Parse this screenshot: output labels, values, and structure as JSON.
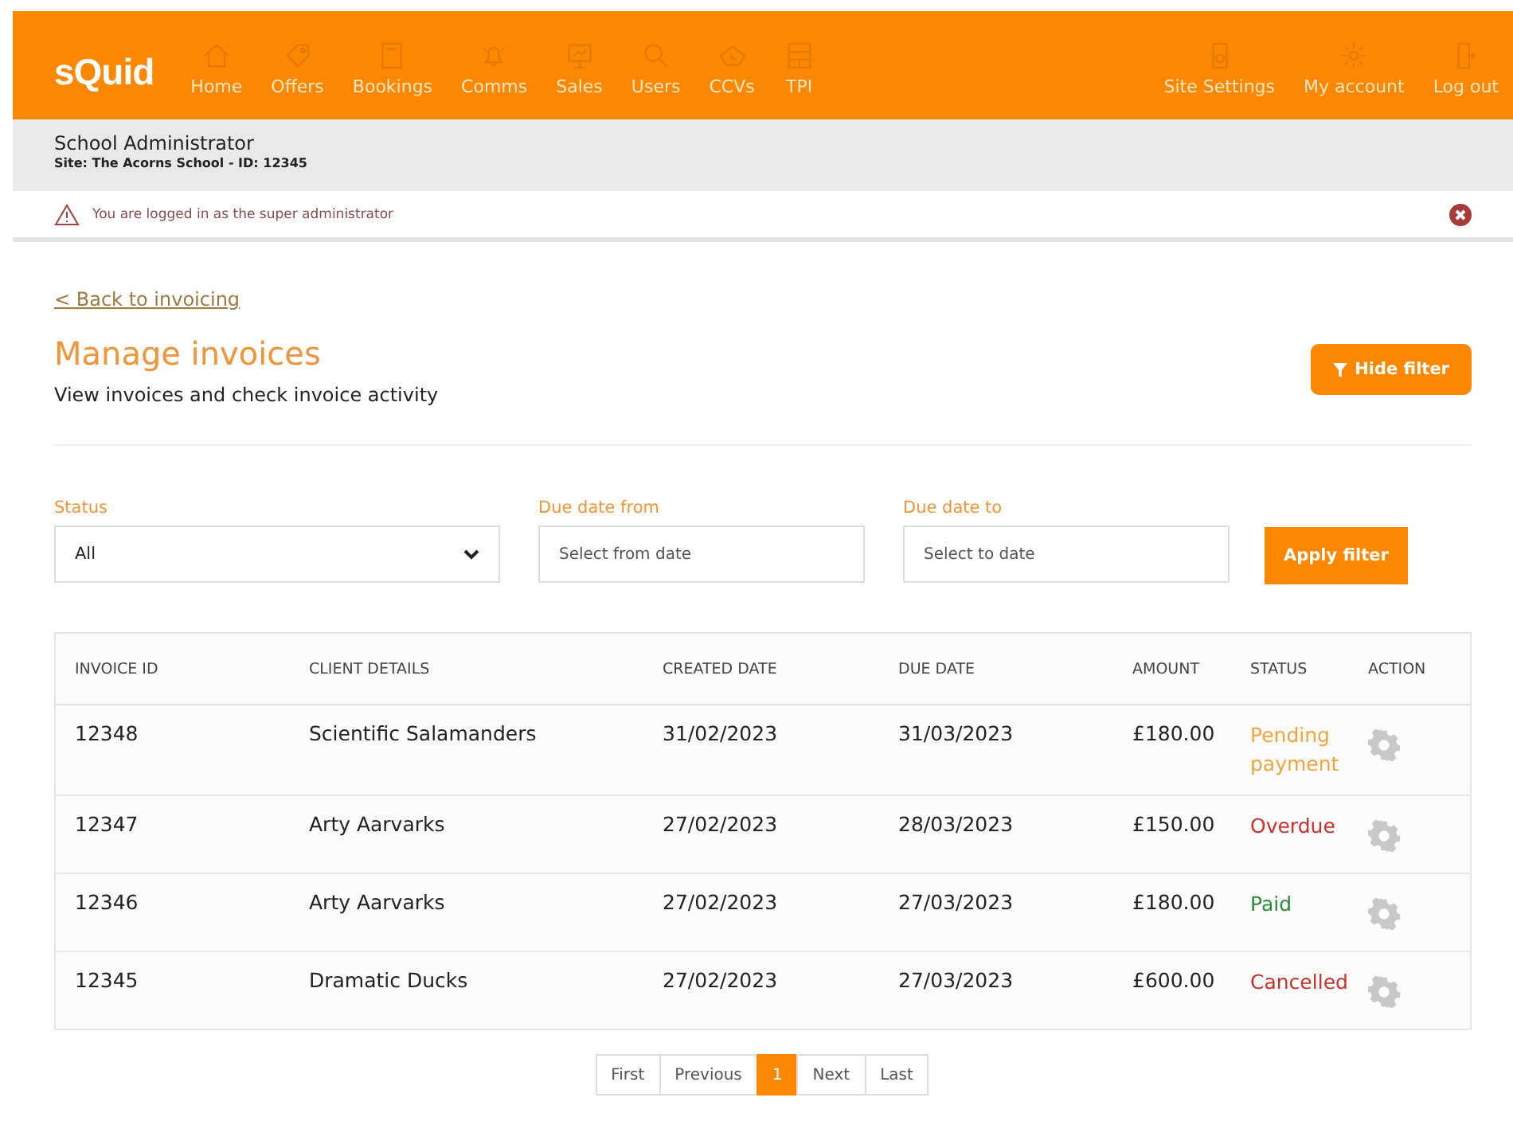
{
  "header": {
    "logo": "sQuid",
    "nav": [
      {
        "label": "Home"
      },
      {
        "label": "Offers"
      },
      {
        "label": "Bookings"
      },
      {
        "label": "Comms"
      },
      {
        "label": "Sales"
      },
      {
        "label": "Users"
      },
      {
        "label": "CCVs"
      },
      {
        "label": "TPI"
      }
    ],
    "nav_right": [
      {
        "label": "Site Settings"
      },
      {
        "label": "My account"
      },
      {
        "label": "Log out"
      }
    ]
  },
  "user_bar": {
    "role": "School Administrator",
    "site": "Site: The Acorns School - ID:  12345"
  },
  "alert": {
    "message": "You are logged in as the super administrator"
  },
  "back_link": "< Back to invoicing",
  "page": {
    "title": "Manage invoices",
    "subtitle": "View invoices and check invoice activity",
    "hide_filter_button": "Hide filter"
  },
  "filters": {
    "status": {
      "label": "Status",
      "value": "All"
    },
    "due_from": {
      "label": "Due date from",
      "placeholder": "Select from date"
    },
    "due_to": {
      "label": "Due date to",
      "placeholder": "Select to date"
    },
    "apply_button": "Apply filter"
  },
  "table": {
    "columns": [
      "INVOICE ID",
      "CLIENT DETAILS",
      "CREATED DATE",
      "DUE DATE",
      "AMOUNT",
      "STATUS",
      "ACTION"
    ],
    "rows": [
      {
        "invoice_id": "12348",
        "client": "Scientific Salamanders",
        "created": "31/02/2023",
        "due": "31/03/2023",
        "amount": "£180.00",
        "status": "Pending payment",
        "color": "#f0a640"
      },
      {
        "invoice_id": "12347",
        "client": "Arty Aarvarks",
        "created": "27/02/2023",
        "due": "28/03/2023",
        "amount": "£150.00",
        "status": "Overdue",
        "color": "#c8322d"
      },
      {
        "invoice_id": "12346",
        "client": "Arty Aarvarks",
        "created": "27/02/2023",
        "due": "27/03/2023",
        "amount": "£180.00",
        "status": "Paid",
        "color": "#2e8b3a"
      },
      {
        "invoice_id": "12345",
        "client": "Dramatic Ducks",
        "created": "27/02/2023",
        "due": "27/03/2023",
        "amount": "£600.00",
        "status": "Cancelled",
        "color": "#c8322d"
      }
    ]
  },
  "pagination": [
    {
      "label": "First",
      "selected": false
    },
    {
      "label": "Previous",
      "selected": false
    },
    {
      "label": "1",
      "selected": true
    },
    {
      "label": "Next",
      "selected": false
    },
    {
      "label": "Last",
      "selected": false
    }
  ]
}
